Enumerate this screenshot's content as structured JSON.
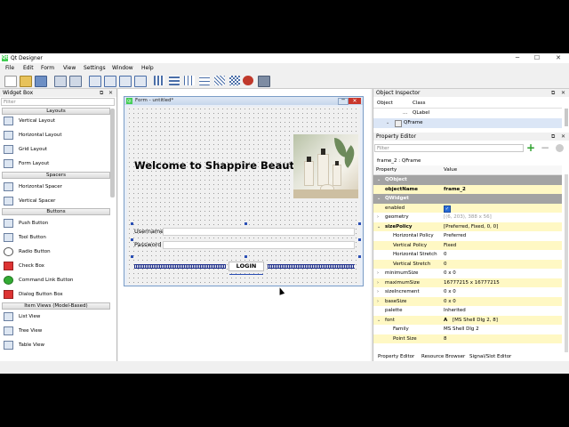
{
  "app": {
    "title": "Qt Designer",
    "logo_text": "Qt",
    "min": "─",
    "max": "☐",
    "close": "✕"
  },
  "menu": [
    "File",
    "Edit",
    "Form",
    "View",
    "Settings",
    "Window",
    "Help"
  ],
  "widget_box": {
    "title": "Widget Box",
    "filter_placeholder": "Filter",
    "categories": {
      "layouts": "Layouts",
      "spacers": "Spacers",
      "buttons": "Buttons",
      "item_views": "Item Views (Model-Based)"
    },
    "items": {
      "vertical_layout": "Vertical Layout",
      "horizontal_layout": "Horizontal Layout",
      "grid_layout": "Grid Layout",
      "form_layout": "Form Layout",
      "horizontal_spacer": "Horizontal Spacer",
      "vertical_spacer": "Vertical Spacer",
      "push_button": "Push Button",
      "tool_button": "Tool Button",
      "radio_button": "Radio Button",
      "check_box": "Check Box",
      "command_link_button": "Command Link Button",
      "dialog_button_box": "Dialog Button Box",
      "list_view": "List View",
      "tree_view": "Tree View",
      "table_view": "Table View"
    }
  },
  "form": {
    "title": "Form - untitled*",
    "heading": "Welcome to Shappire Beauty",
    "username_label": "Username",
    "password_label": "Password",
    "login_label": "LOGIN"
  },
  "object_inspector": {
    "title": "Object Inspector",
    "col_object": "Object",
    "col_class": "Class",
    "row1_class": "QLabel",
    "row2_class": "QFrame",
    "row1_object": "..."
  },
  "property_editor": {
    "title": "Property Editor",
    "filter_placeholder": "Filter",
    "selected": "frame_2 : QFrame",
    "col_property": "Property",
    "col_value": "Value",
    "rows": [
      {
        "name": "QObject",
        "value": ""
      },
      {
        "name": "objectName",
        "value": "frame_2"
      },
      {
        "name": "QWidget",
        "value": ""
      },
      {
        "name": "enabled",
        "value": ""
      },
      {
        "name": "geometry",
        "value": "[(6, 203), 388 x 56]"
      },
      {
        "name": "sizePolicy",
        "value": "[Preferred, Fixed, 0, 0]"
      },
      {
        "name": "Horizontal Policy",
        "value": "Preferred"
      },
      {
        "name": "Vertical Policy",
        "value": "Fixed"
      },
      {
        "name": "Horizontal Stretch",
        "value": "0"
      },
      {
        "name": "Vertical Stretch",
        "value": "0"
      },
      {
        "name": "minimumSize",
        "value": "0 x 0"
      },
      {
        "name": "maximumSize",
        "value": "16777215 x 16777215"
      },
      {
        "name": "sizeIncrement",
        "value": "0 x 0"
      },
      {
        "name": "baseSize",
        "value": "0 x 0"
      },
      {
        "name": "palette",
        "value": "Inherited"
      },
      {
        "name": "font",
        "value": "[MS Shell Dlg 2, 8]"
      },
      {
        "name": "Family",
        "value": "MS Shell Dlg 2"
      },
      {
        "name": "Point Size",
        "value": "8"
      }
    ],
    "font_glyph": "A",
    "add_glyph": "+",
    "remove_glyph": "−"
  },
  "bottom_tabs": [
    "Property Editor",
    "Resource Browser",
    "Signal/Slot Editor"
  ],
  "colors": {
    "accent": "#1e2f8c",
    "handle": "#2b4fb4",
    "section_header": "#a0a0a0",
    "highlight_row": "#fff8c4"
  }
}
